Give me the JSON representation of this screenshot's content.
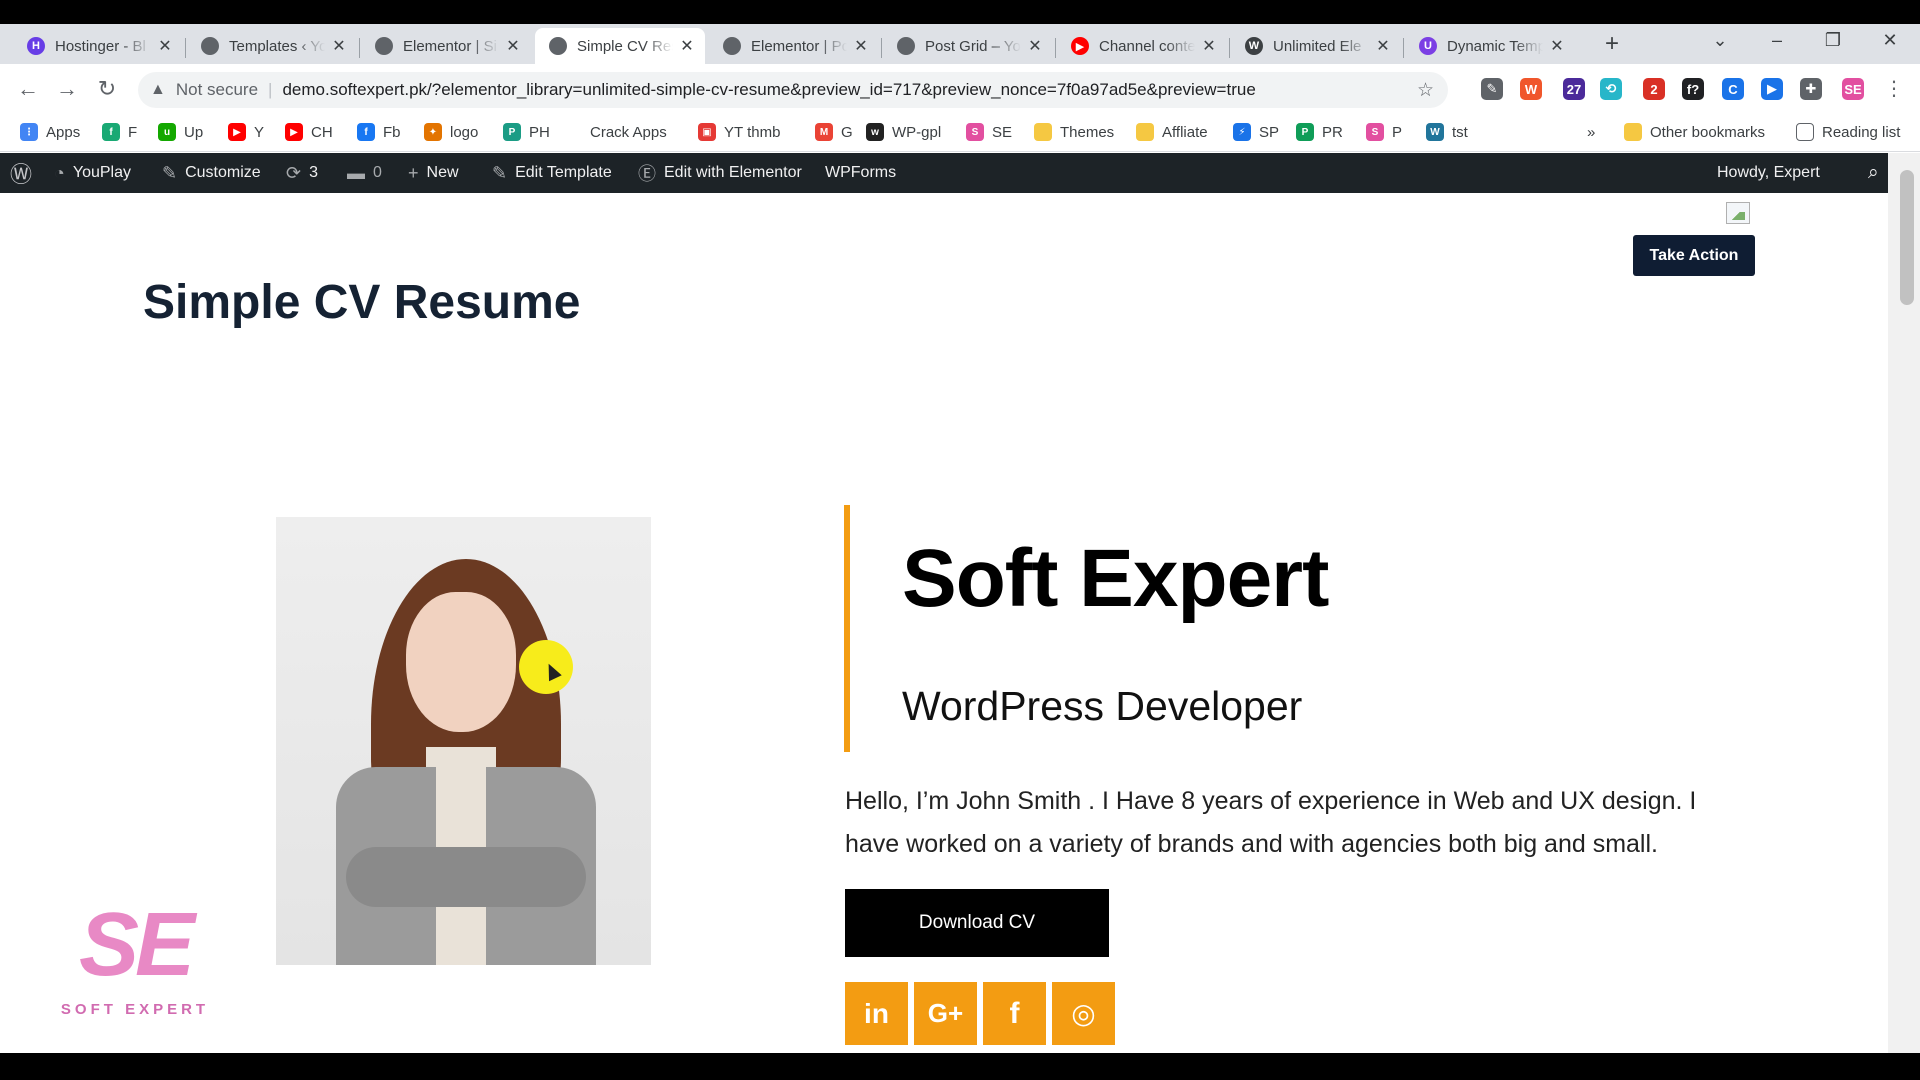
{
  "browser": {
    "tabs": [
      {
        "title": "Hostinger - Bl",
        "fav_color": "#673de6",
        "fav_glyph": "H"
      },
      {
        "title": "Templates ‹ Yo",
        "fav_color": "#5f6368",
        "fav_glyph": ""
      },
      {
        "title": "Elementor | Si",
        "fav_color": "#5f6368",
        "fav_glyph": ""
      },
      {
        "title": "Simple CV Res",
        "fav_color": "#5f6368",
        "fav_glyph": "",
        "active": true
      },
      {
        "title": "Elementor | Pc",
        "fav_color": "#5f6368",
        "fav_glyph": ""
      },
      {
        "title": "Post Grid – Yo",
        "fav_color": "#5f6368",
        "fav_glyph": ""
      },
      {
        "title": "Channel conte",
        "fav_color": "#ff0000",
        "fav_glyph": "▶"
      },
      {
        "title": "Unlimited Ele",
        "fav_color": "#3c4043",
        "fav_glyph": "W"
      },
      {
        "title": "Dynamic Temp",
        "fav_color": "#7b3fe4",
        "fav_glyph": "U"
      }
    ],
    "new_tab_glyph": "+",
    "address": {
      "security_label": "Not secure",
      "url": "demo.softexpert.pk/?elementor_library=unlimited-simple-cv-resume&preview_id=717&preview_nonce=7f0a97ad5e&preview=true"
    },
    "extensions": [
      {
        "icon": "eyedropper-icon",
        "color": "#5f6368",
        "glyph": "✎"
      },
      {
        "icon": "wappalyzer-icon",
        "color": "#f0562b",
        "glyph": "W"
      },
      {
        "icon": "graduation-cap-icon",
        "color": "#4b2a9a",
        "glyph": "27"
      },
      {
        "icon": "sync-icon",
        "color": "#27b6c9",
        "glyph": "⟲"
      },
      {
        "icon": "shield-badge-icon",
        "color": "#d93025",
        "glyph": "2"
      },
      {
        "icon": "font-finder-icon",
        "color": "#202124",
        "glyph": "f?"
      },
      {
        "icon": "c-extension-icon",
        "color": "#1a73e8",
        "glyph": "C"
      },
      {
        "icon": "play-extension-icon",
        "color": "#1a73e8",
        "glyph": "▶"
      },
      {
        "icon": "puzzle-icon",
        "color": "#5f6368",
        "glyph": "✚"
      },
      {
        "icon": "se-extension-icon",
        "color": "#e24fa0",
        "glyph": "SE"
      }
    ],
    "bookmarks": [
      {
        "label": "Apps",
        "color": "#4285f4",
        "glyph": "⋮"
      },
      {
        "label": "F",
        "color": "#19a974",
        "glyph": "f"
      },
      {
        "label": "Up",
        "color": "#14a800",
        "glyph": "u"
      },
      {
        "label": "Y",
        "color": "#ff0000",
        "glyph": "▶"
      },
      {
        "label": "CH",
        "color": "#ff0000",
        "glyph": "▶"
      },
      {
        "label": "Fb",
        "color": "#1877f2",
        "glyph": "f"
      },
      {
        "label": "logo",
        "color": "#e37400",
        "glyph": "✦"
      },
      {
        "label": "PH",
        "color": "#1b9c85",
        "glyph": "P"
      },
      {
        "label": "Crack Apps",
        "color": "",
        "glyph": ""
      },
      {
        "label": "YT thmb",
        "color": "#e53935",
        "glyph": "▣"
      },
      {
        "label": "G",
        "color": "#ea4335",
        "glyph": "M"
      },
      {
        "label": "WP-gpl",
        "color": "#222222",
        "glyph": "w"
      },
      {
        "label": "SE",
        "color": "#e24fa0",
        "glyph": "S"
      },
      {
        "label": "Themes",
        "color": "#f5c842",
        "glyph": ""
      },
      {
        "label": "Affliate",
        "color": "#f5c842",
        "glyph": ""
      },
      {
        "label": "SP",
        "color": "#1a73e8",
        "glyph": "⚡"
      },
      {
        "label": "PR",
        "color": "#0f9d58",
        "glyph": "P"
      },
      {
        "label": "P",
        "color": "#e24fa0",
        "glyph": "S"
      },
      {
        "label": "tst",
        "color": "#21759b",
        "glyph": "W"
      }
    ],
    "overflow_glyph": "»",
    "other_bookmarks": "Other bookmarks",
    "reading_list": "Reading list"
  },
  "adminbar": {
    "site_name": "YouPlay",
    "customize": "Customize",
    "updates_count": "3",
    "comments_count": "0",
    "new": "New",
    "edit_template": "Edit Template",
    "edit_with_elementor": "Edit with Elementor",
    "wpforms": "WPForms",
    "howdy": "Howdy, Expert"
  },
  "page": {
    "title": "Simple CV Resume",
    "take_action": "Take Action",
    "name": "Soft Expert",
    "role": "WordPress Developer",
    "bio": "Hello, I’m John Smith . I Have 8 years of experience in Web and UX design. I have worked on a variety of brands and with agencies both big and small.",
    "download_label": "Download CV",
    "social": [
      {
        "icon": "linkedin-icon",
        "glyph": "in"
      },
      {
        "icon": "google-plus-icon",
        "glyph": "G+"
      },
      {
        "icon": "facebook-icon",
        "glyph": "f"
      },
      {
        "icon": "instagram-icon",
        "glyph": "◎"
      }
    ],
    "accent_color": "#f39c12",
    "logo": {
      "mark": "SE",
      "text": "SOFT EXPERT",
      "color": "#e889c5"
    }
  }
}
